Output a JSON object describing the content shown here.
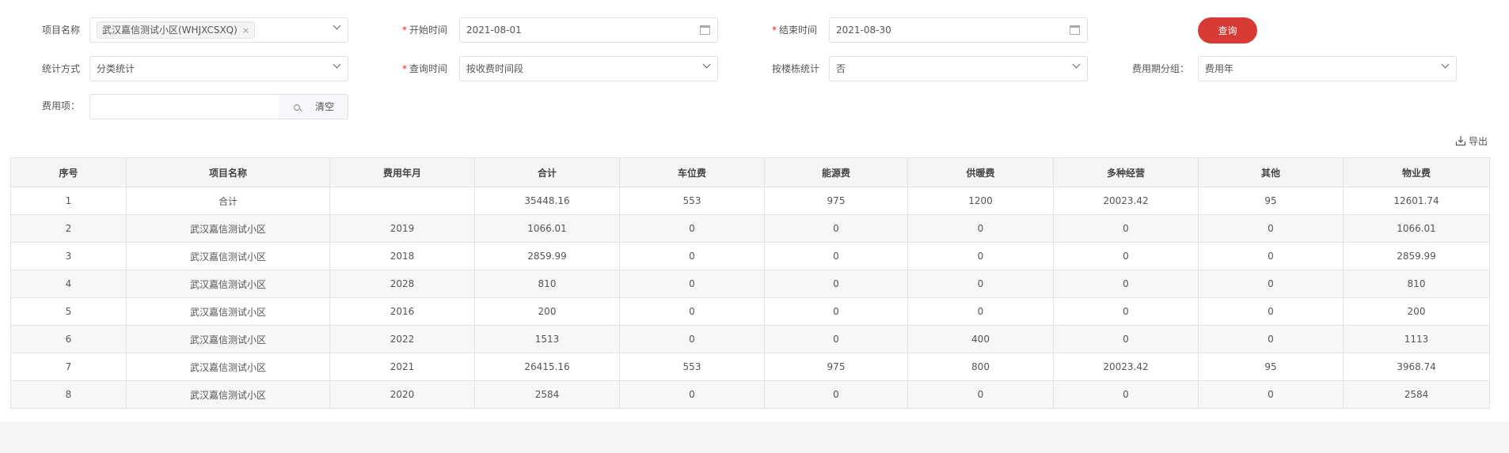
{
  "filters": {
    "project_label": "项目名称",
    "project_tag": "武汉嘉信测试小区(WHJXCSXQ)",
    "project_tag_close": "×",
    "start_label": "开始时间",
    "start_value": "2021-08-01",
    "end_label": "结束时间",
    "end_value": "2021-08-30",
    "query_button": "查询",
    "stat_method_label": "统计方式",
    "stat_method_value": "分类统计",
    "query_time_label": "查询时间",
    "query_time_value": "按收费时间段",
    "by_building_label": "按楼栋统计",
    "by_building_value": "否",
    "period_group_label": "费用期分组：",
    "period_group_value": "费用年",
    "fee_item_label": "费用项：",
    "fee_item_value": "",
    "clear_button": "清空",
    "required_mark": "*"
  },
  "toolbar": {
    "export_label": "导出"
  },
  "table": {
    "headers": [
      "序号",
      "项目名称",
      "费用年月",
      "合计",
      "车位费",
      "能源费",
      "供暖费",
      "多种经营",
      "其他",
      "物业费"
    ],
    "rows": [
      [
        "1",
        "合计",
        "",
        "35448.16",
        "553",
        "975",
        "1200",
        "20023.42",
        "95",
        "12601.74"
      ],
      [
        "2",
        "武汉嘉信测试小区",
        "2019",
        "1066.01",
        "0",
        "0",
        "0",
        "0",
        "0",
        "1066.01"
      ],
      [
        "3",
        "武汉嘉信测试小区",
        "2018",
        "2859.99",
        "0",
        "0",
        "0",
        "0",
        "0",
        "2859.99"
      ],
      [
        "4",
        "武汉嘉信测试小区",
        "2028",
        "810",
        "0",
        "0",
        "0",
        "0",
        "0",
        "810"
      ],
      [
        "5",
        "武汉嘉信测试小区",
        "2016",
        "200",
        "0",
        "0",
        "0",
        "0",
        "0",
        "200"
      ],
      [
        "6",
        "武汉嘉信测试小区",
        "2022",
        "1513",
        "0",
        "0",
        "400",
        "0",
        "0",
        "1113"
      ],
      [
        "7",
        "武汉嘉信测试小区",
        "2021",
        "26415.16",
        "553",
        "975",
        "800",
        "20023.42",
        "95",
        "3968.74"
      ],
      [
        "8",
        "武汉嘉信测试小区",
        "2020",
        "2584",
        "0",
        "0",
        "0",
        "0",
        "0",
        "2584"
      ]
    ]
  },
  "colors": {
    "primary": "#d83a35",
    "required": "#e02020"
  }
}
